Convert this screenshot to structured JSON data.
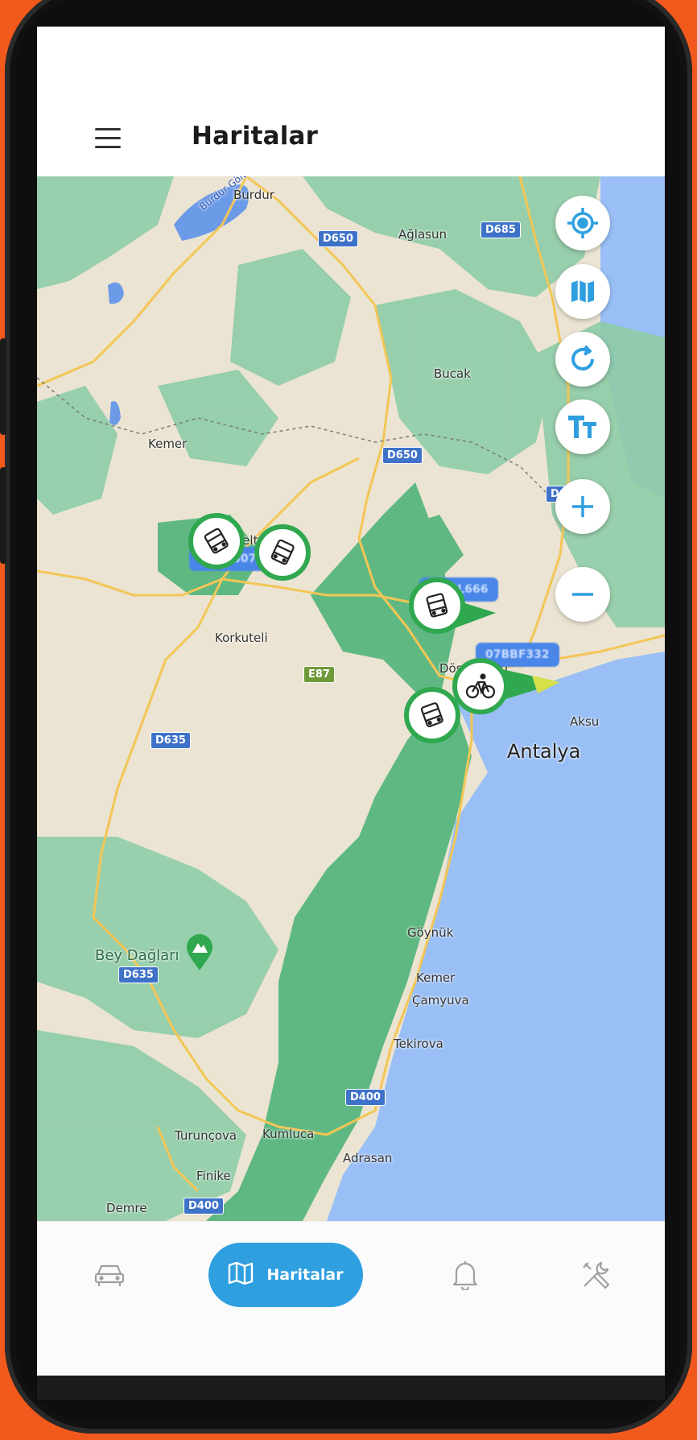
{
  "header": {
    "title": "Haritalar",
    "menu_icon": "hamburger-menu-icon"
  },
  "map": {
    "places": [
      "Burdur",
      "Ağlasun",
      "Bucak",
      "Kemer",
      "Yelten",
      "Korkuteli",
      "Döşemealtı",
      "Aksu",
      "Antalya",
      "Göynük",
      "Kemer",
      "Çamyuva",
      "Tekirova",
      "Bey Dağları",
      "Turunçova",
      "Kumluca",
      "Finike",
      "Adrasan",
      "Demre",
      "Burdur Gölü"
    ],
    "roads": [
      "D650",
      "D685",
      "D650",
      "D685",
      "E87",
      "D635",
      "D635",
      "D400",
      "D400"
    ],
    "vehicle_labels": [
      "07AGS074",
      "07BIL666",
      "07BBF332"
    ],
    "vehicles": [
      {
        "type": "bus-icon"
      },
      {
        "type": "bus-icon"
      },
      {
        "type": "bus-icon"
      },
      {
        "type": "bicycle-icon"
      },
      {
        "type": "bus-icon"
      }
    ]
  },
  "controls": [
    "locate-icon",
    "map-layers-icon",
    "refresh-icon",
    "text-size-icon",
    "zoom-in-icon",
    "zoom-out-icon"
  ],
  "nav": {
    "vehicles_icon": "car-icon",
    "active_label": "Haritalar",
    "active_icon": "map-icon",
    "notifications_icon": "bell-icon",
    "settings_icon": "tools-icon"
  },
  "colors": {
    "accent": "#2f9fe0",
    "marker_green": "#2fa84f",
    "water": "#99bff6",
    "background": "#f25a1d"
  }
}
